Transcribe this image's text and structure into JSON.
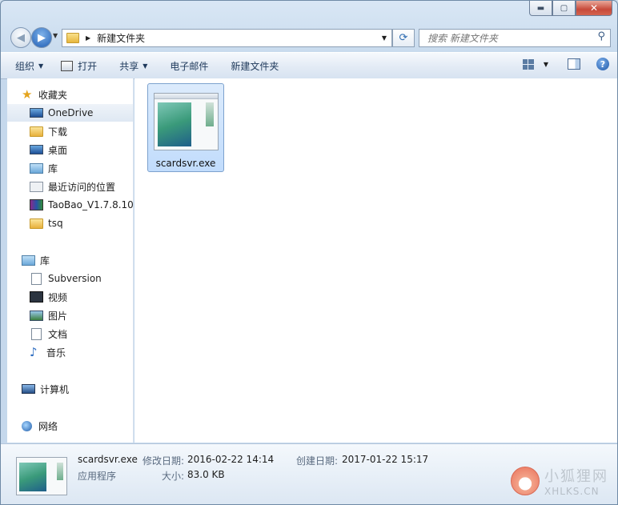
{
  "window": {
    "caption_buttons": {
      "minimize": "▬",
      "maximize": "▢",
      "close": "✕"
    }
  },
  "nav": {
    "back_icon": "arrow-left-icon",
    "forward_icon": "arrow-right-icon",
    "address_segment": "新建文件夹",
    "search_placeholder": "搜索 新建文件夹"
  },
  "toolbar": {
    "organize": "组织",
    "open": "打开",
    "share": "共享",
    "email": "电子邮件",
    "new_folder": "新建文件夹"
  },
  "sidebar": {
    "favorites_label": "收藏夹",
    "favorites": [
      "OneDrive",
      "下载",
      "桌面",
      "库",
      "最近访问的位置",
      "TaoBao_V1.7.8.10_",
      "tsq"
    ],
    "libraries_label": "库",
    "libraries": [
      "Subversion",
      "视频",
      "图片",
      "文档",
      "音乐"
    ],
    "computer_label": "计算机",
    "network_label": "网络"
  },
  "files": [
    {
      "name": "scardsvr.exe",
      "selected": true
    }
  ],
  "details": {
    "filename": "scardsvr.exe",
    "type": "应用程序",
    "modified_label": "修改日期:",
    "modified_value": "2016-02-22 14:14",
    "created_label": "创建日期:",
    "created_value": "2017-01-22 15:17",
    "size_label": "大小:",
    "size_value": "83.0 KB"
  },
  "watermark": {
    "cn": "小狐狸网",
    "en": "XHLKS.CN"
  }
}
